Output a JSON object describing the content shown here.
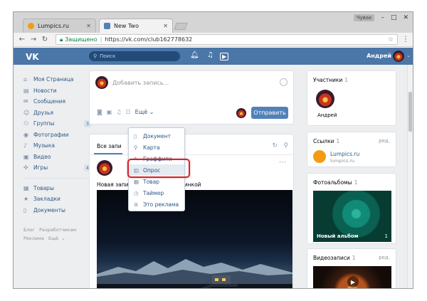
{
  "browser": {
    "tabs": [
      {
        "title": "Lumpics.ru",
        "favicon_color": "#f39c12"
      },
      {
        "title": "New Two",
        "favicon_color": "#5181b8"
      }
    ],
    "user_chip": "Чувак",
    "omnibox": {
      "secure_label": "Защищено",
      "url": "https://vk.com/club162778632"
    }
  },
  "vk": {
    "logo": "VK",
    "search_placeholder": "Поиск",
    "user_name": "Андрей"
  },
  "sidebar": {
    "items": [
      {
        "label": "Моя Страница",
        "icon": "home-icon",
        "count": ""
      },
      {
        "label": "Новости",
        "icon": "news-icon",
        "count": ""
      },
      {
        "label": "Сообщения",
        "icon": "message-icon",
        "count": ""
      },
      {
        "label": "Друзья",
        "icon": "friend-icon",
        "count": ""
      },
      {
        "label": "Группы",
        "icon": "groups-icon",
        "count": "3"
      },
      {
        "label": "Фотографии",
        "icon": "camera-icon",
        "count": ""
      },
      {
        "label": "Музыка",
        "icon": "music-icon",
        "count": ""
      },
      {
        "label": "Видео",
        "icon": "video-icon",
        "count": ""
      },
      {
        "label": "Игры",
        "icon": "games-icon",
        "count": "4"
      }
    ],
    "extra_items": [
      {
        "label": "Товары",
        "icon": "goods-icon"
      },
      {
        "label": "Закладки",
        "icon": "star-icon"
      },
      {
        "label": "Документы",
        "icon": "document-icon"
      }
    ],
    "footer": [
      "Блог",
      "Разработчикам",
      "Реклама",
      "Ещё"
    ]
  },
  "composer": {
    "placeholder": "Добавить запись...",
    "more_label": "Ещё",
    "send_label": "Отправить"
  },
  "dropdown": {
    "items": [
      "Документ",
      "Карта",
      "Граффити",
      "Опрос",
      "Товар",
      "Таймер",
      "Это реклама"
    ],
    "active_index": 3
  },
  "feed": {
    "tab_all": "Все запи",
    "tab_hidden": "а",
    "post_text": "Новая запи",
    "post_text_tail": "картинкой"
  },
  "right": {
    "members_title": "Участники",
    "members_count": "1",
    "member_name": "Андрей",
    "links_title": "Ссылки",
    "links_count": "1",
    "links_edit": "ред.",
    "link_title": "Lumpics.ru",
    "link_url": "lumpics.ru",
    "albums_title": "Фотоальбомы",
    "albums_count": "1",
    "album_caption": "Новый альбом",
    "album_count": "1",
    "videos_title": "Видеозаписи",
    "videos_count": "1",
    "videos_edit": "ред."
  },
  "colors": {
    "vk_blue": "#4a76a8",
    "button_blue": "#5181b8",
    "highlight_red": "#d4232a"
  }
}
